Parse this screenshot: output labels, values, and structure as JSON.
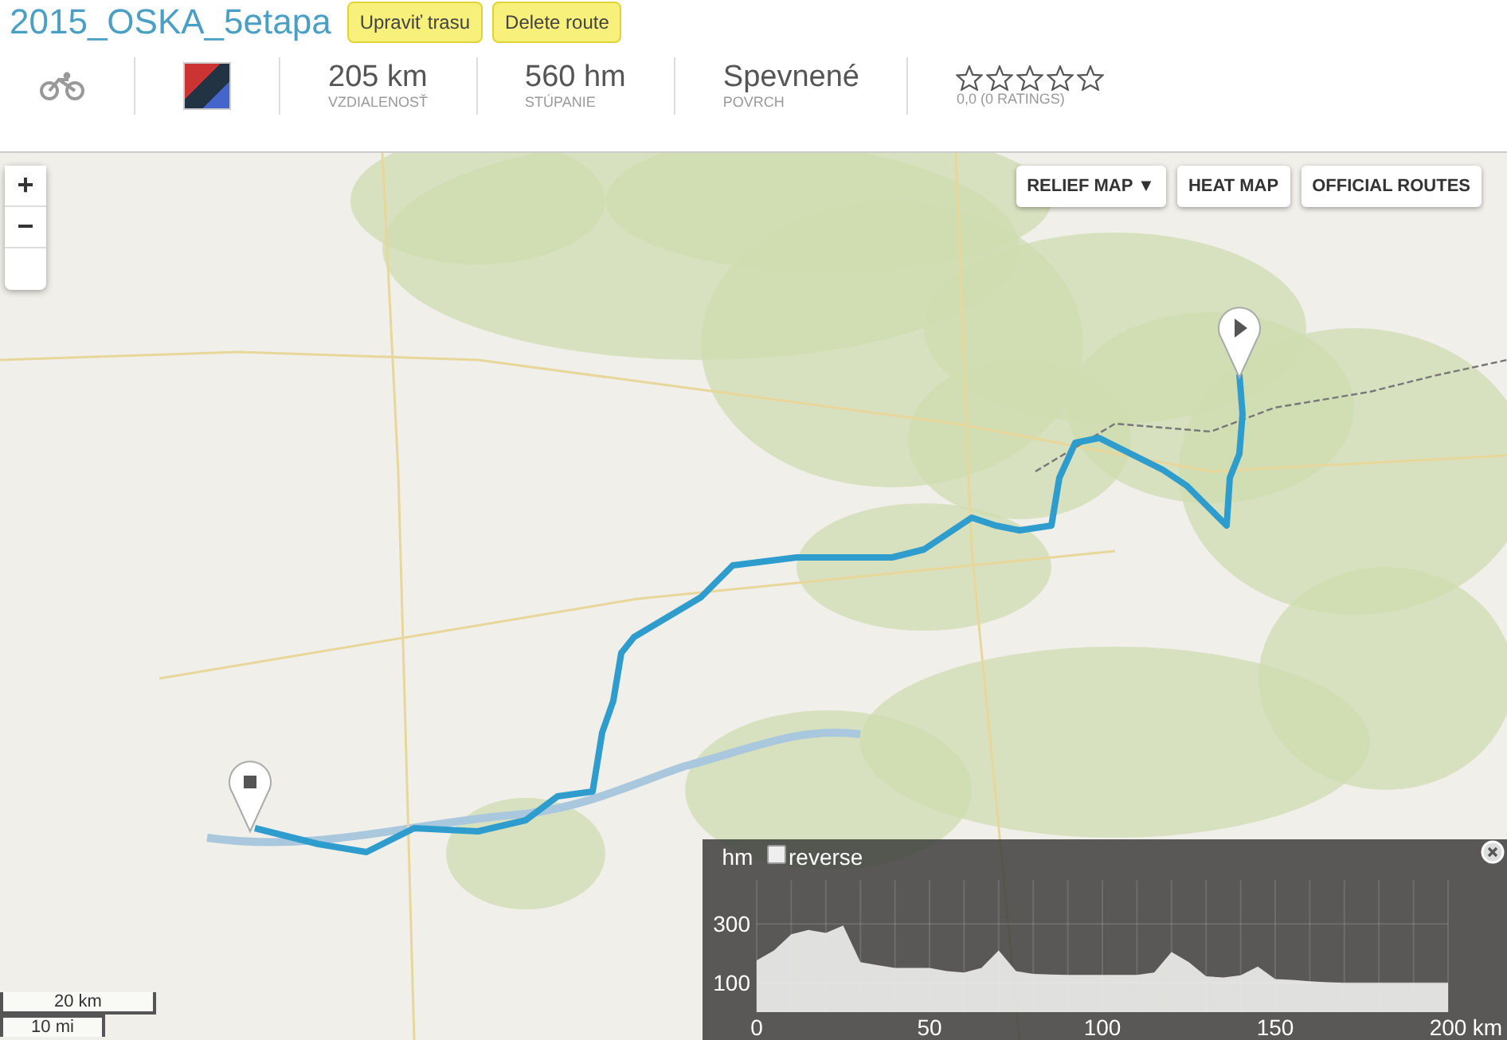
{
  "route": {
    "title": "2015_OSKA_5etapa",
    "buttons": [
      {
        "label": "Upraviť trasu"
      },
      {
        "label": "Delete route"
      }
    ]
  },
  "stats": [
    {
      "value": "205 km",
      "label": "VZDIALENOSŤ"
    },
    {
      "value": "560 hm",
      "label": "STÚPANIE"
    },
    {
      "value": "Spevnené",
      "label": "POVRCH"
    }
  ],
  "rating": {
    "stars": 0,
    "text": "0,0 (0 RATINGS)"
  },
  "map": {
    "zoom_controls": [
      "+",
      "−"
    ],
    "layers": [
      {
        "label": "RELIEF MAP ▼"
      },
      {
        "label": "HEAT MAP"
      },
      {
        "label": "OFFICIAL ROUTES"
      }
    ],
    "scale": [
      "20 km",
      "10 mi"
    ]
  },
  "elevation": {
    "reverse": {
      "label": "reverse",
      "checked": false
    },
    "chart_data": {
      "type": "area",
      "grid": true,
      "xlabel": "km",
      "ylabel": "hm",
      "xlim": [
        0,
        200
      ],
      "ylim": [
        0,
        450
      ],
      "xticks": [
        0,
        50,
        100,
        150,
        200
      ],
      "yticks": [
        100,
        300
      ],
      "x": [
        0,
        5,
        10,
        15,
        20,
        25,
        30,
        35,
        40,
        45,
        50,
        55,
        60,
        65,
        70,
        75,
        80,
        85,
        90,
        95,
        100,
        105,
        110,
        115,
        120,
        125,
        130,
        135,
        140,
        145,
        150,
        155,
        160,
        165,
        170,
        175,
        180,
        185,
        190,
        195,
        200
      ],
      "series": [
        {
          "color": "#f2f2f2",
          "values": [
            176,
            210,
            265,
            280,
            270,
            295,
            170,
            160,
            150,
            150,
            150,
            140,
            135,
            150,
            210,
            140,
            130,
            128,
            127,
            127,
            127,
            127,
            127,
            135,
            205,
            170,
            122,
            118,
            125,
            155,
            112,
            110,
            105,
            102,
            100,
            100,
            100,
            100,
            100,
            100,
            100
          ]
        }
      ]
    }
  }
}
